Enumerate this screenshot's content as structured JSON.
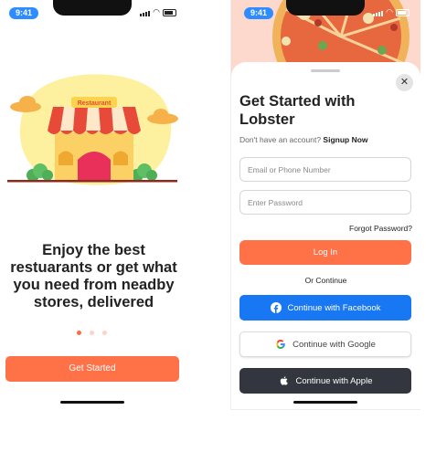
{
  "status_bar": {
    "time": "9:41"
  },
  "onboarding": {
    "illustration": {
      "sign_text": "Restaurant"
    },
    "headline": "Enjoy the best restuarants or get what you need from neadby stores, delivered",
    "dots": {
      "count": 3,
      "active_index": 0
    },
    "cta_label": "Get Started"
  },
  "signup": {
    "title": "Get Started with Lobster",
    "no_account_text": "Don't have an account?",
    "signup_link": "Signup Now",
    "email_placeholder": "Email or Phone Number",
    "password_placeholder": "Enter Password",
    "forgot_password": "Forgot Password?",
    "login_label": "Log In",
    "or_continue": "Or Continue",
    "facebook_label": "Continue with Facebook",
    "google_label": "Continue with Google",
    "apple_label": "Continue with Apple",
    "close_symbol": "✕"
  },
  "colors": {
    "accent": "#ff7248",
    "status_blue": "#2d8cff",
    "facebook": "#1877f2",
    "apple": "#33363f"
  }
}
